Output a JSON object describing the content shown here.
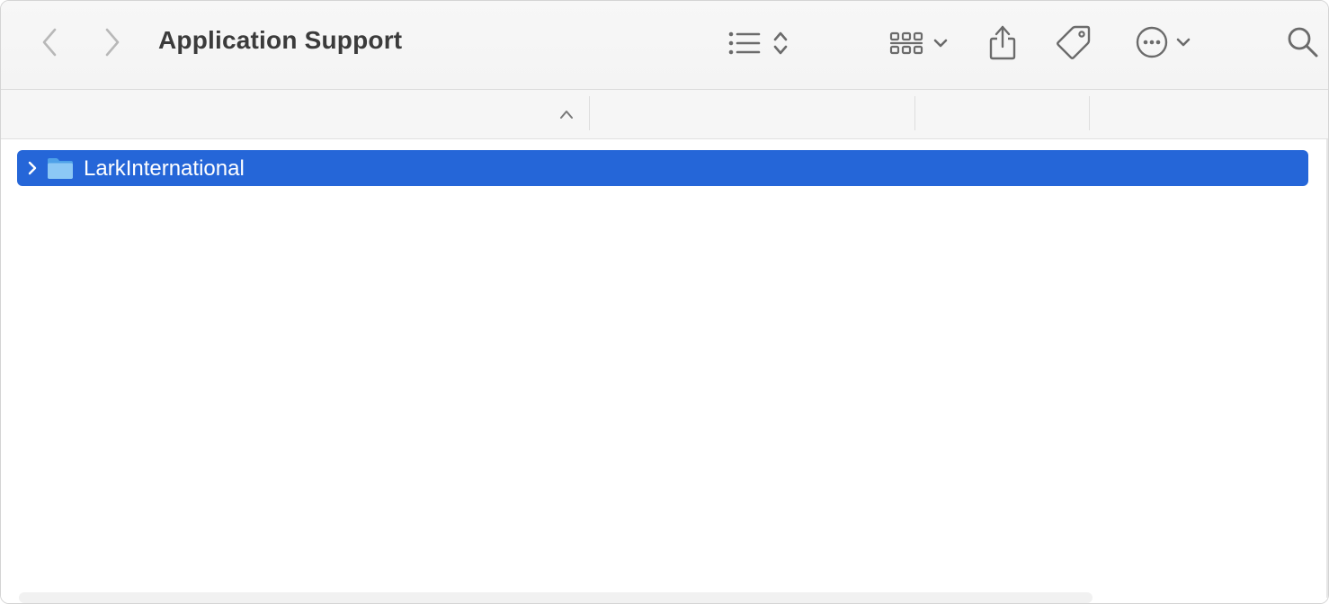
{
  "window": {
    "title": "Application Support"
  },
  "toolbar": {
    "back_icon": "chevron-left-icon",
    "forward_icon": "chevron-right-icon",
    "view_list_icon": "list-icon",
    "view_sort_icon": "up-down-chevron-icon",
    "group_icon": "grid-icon",
    "share_icon": "share-icon",
    "tag_icon": "tag-icon",
    "more_icon": "ellipsis-circle-icon",
    "search_icon": "search-icon"
  },
  "columns": {
    "name_sorted_ascending": true,
    "sort_indicator_icon": "chevron-up-icon"
  },
  "files": [
    {
      "name": "LarkInternational",
      "type": "folder",
      "selected": true,
      "expanded": false
    }
  ],
  "colors": {
    "selection": "#2566d8",
    "folder": "#6ab4f0",
    "toolbar_icon": "#6b6b6b",
    "disabled_icon": "#b8b8b8"
  }
}
